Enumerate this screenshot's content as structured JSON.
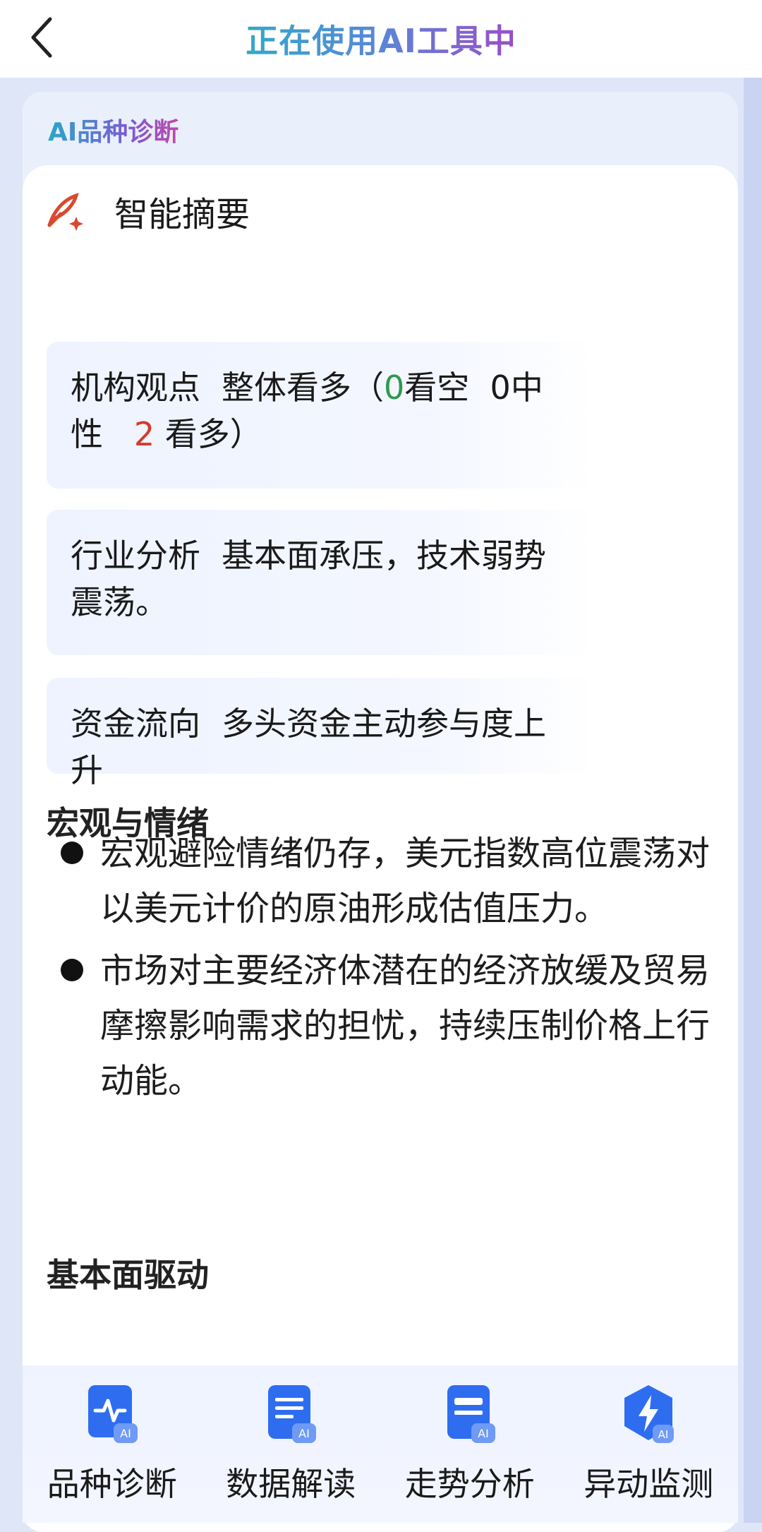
{
  "header": {
    "title": "正在使用AI工具中"
  },
  "card": {
    "title": "AI品种诊断"
  },
  "summary": {
    "heading": "智能摘要",
    "institution": {
      "key": "机构观点",
      "pre": "整体看多（",
      "bear_count": "0",
      "bear_label": "看空",
      "neutral_count": "0",
      "neutral_label": "中性",
      "bull_count": "2",
      "bull_label": "看多",
      "post": "）"
    },
    "industry": {
      "key": "行业分析",
      "value": "基本面承压，技术弱势震荡。"
    },
    "capital": {
      "key": "资金流向",
      "value": "多头资金主动参与度上升"
    }
  },
  "macro": {
    "heading": "宏观与情绪",
    "bullets": [
      "宏观避险情绪仍存，美元指数高位震荡对以美元计价的原油形成估值压力。",
      "市场对主要经济体潜在的经济放缓及贸易摩擦影响需求的担忧，持续压制价格上行动能。"
    ]
  },
  "fundamentals": {
    "heading": "基本面驱动"
  },
  "bottom_tools": [
    {
      "label": "品种诊断",
      "icon": "pulse-ai-icon"
    },
    {
      "label": "数据解读",
      "icon": "document-ai-icon"
    },
    {
      "label": "走势分析",
      "icon": "card-ai-icon"
    },
    {
      "label": "异动监测",
      "icon": "lightning-ai-icon"
    }
  ],
  "colors": {
    "accent_blue": "#2f6df0",
    "bull_red": "#d43a2a",
    "bear_green": "#2e9a4d"
  }
}
